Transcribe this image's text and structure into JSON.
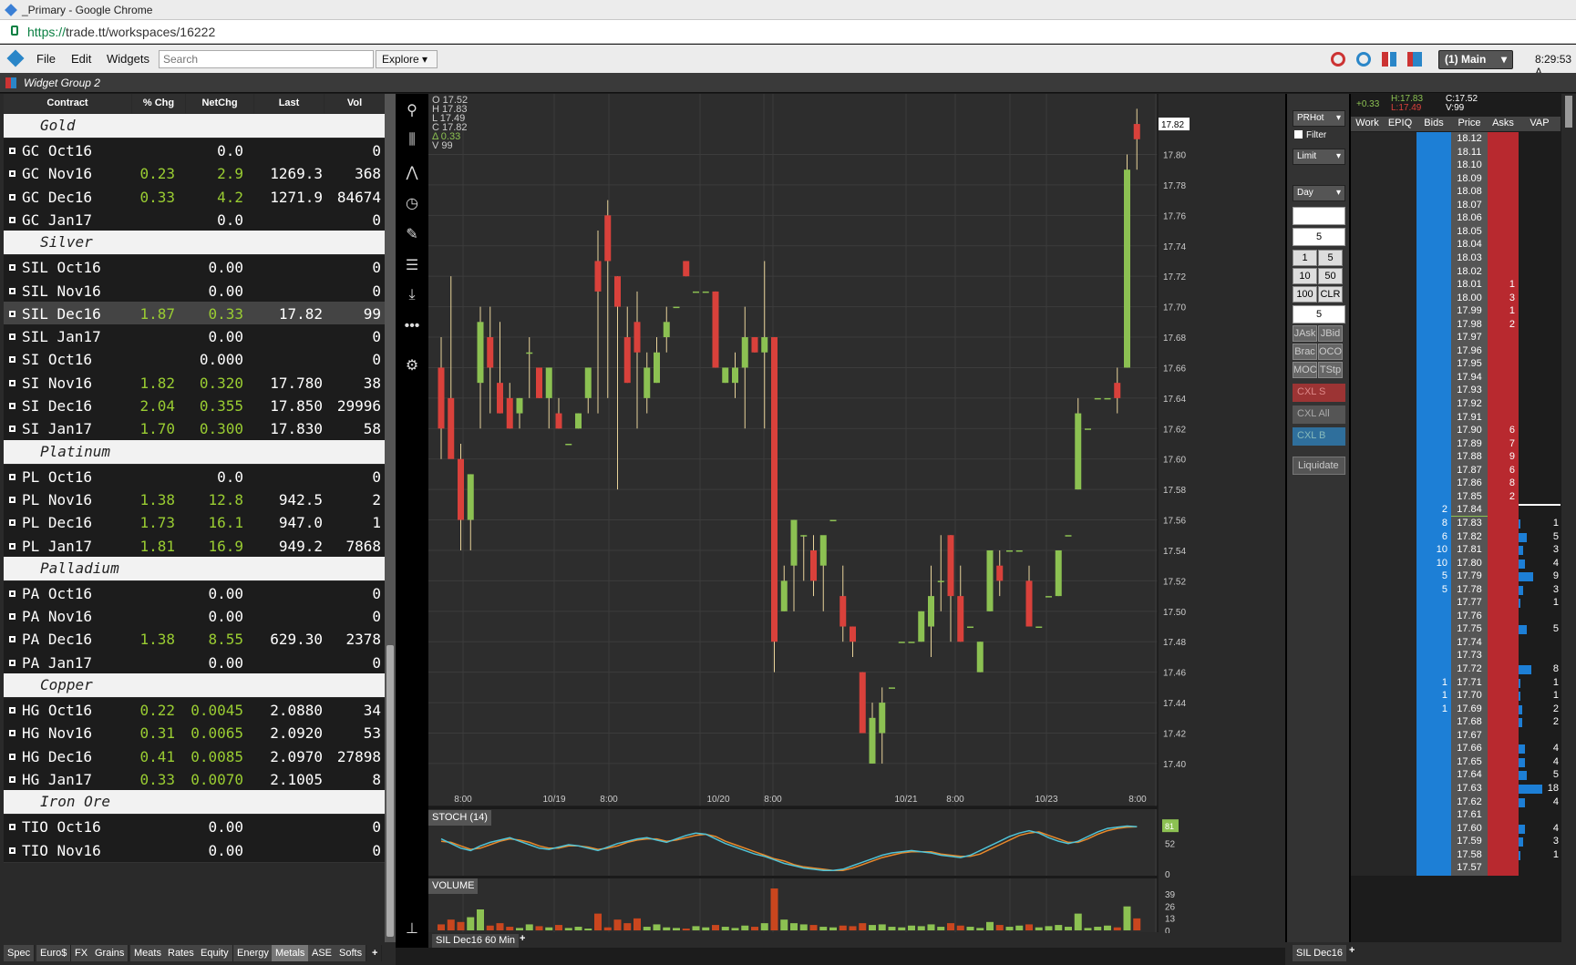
{
  "browser": {
    "window_title": "_Primary - Google Chrome",
    "url_scheme": "https://",
    "url_rest": "trade.tt/workspaces/16222"
  },
  "menu": {
    "file": "File",
    "edit": "Edit",
    "widgets": "Widgets",
    "search_placeholder": "Search",
    "explore": "Explore",
    "workspace": "(1) Main",
    "clock": "8:29:53 A"
  },
  "widget_group": "Widget Group 2",
  "watchlist": {
    "headers": [
      "Contract",
      "% Chg",
      "NetChg",
      "Last",
      "Vol"
    ],
    "groups": [
      {
        "name": "Gold",
        "rows": [
          [
            "GC Oct16",
            "",
            "0.0",
            "",
            "0"
          ],
          [
            "GC Nov16",
            "0.23",
            "2.9",
            "1269.3",
            "368"
          ],
          [
            "GC Dec16",
            "0.33",
            "4.2",
            "1271.9",
            "84674"
          ],
          [
            "GC Jan17",
            "",
            "0.0",
            "",
            "0"
          ]
        ]
      },
      {
        "name": "Silver",
        "rows": [
          [
            "SIL Oct16",
            "",
            "0.00",
            "",
            "0"
          ],
          [
            "SIL Nov16",
            "",
            "0.00",
            "",
            "0"
          ],
          [
            "SIL Dec16",
            "1.87",
            "0.33",
            "17.82",
            "99"
          ],
          [
            "SIL Jan17",
            "",
            "0.00",
            "",
            "0"
          ],
          [
            "SI Oct16",
            "",
            "0.000",
            "",
            "0"
          ],
          [
            "SI Nov16",
            "1.82",
            "0.320",
            "17.780",
            "38"
          ],
          [
            "SI Dec16",
            "2.04",
            "0.355",
            "17.850",
            "29996"
          ],
          [
            "SI Jan17",
            "1.70",
            "0.300",
            "17.830",
            "58"
          ]
        ]
      },
      {
        "name": "Platinum",
        "rows": [
          [
            "PL Oct16",
            "",
            "0.0",
            "",
            "0"
          ],
          [
            "PL Nov16",
            "1.38",
            "12.8",
            "942.5",
            "2"
          ],
          [
            "PL Dec16",
            "1.73",
            "16.1",
            "947.0",
            "1"
          ],
          [
            "PL Jan17",
            "1.81",
            "16.9",
            "949.2",
            "7868"
          ]
        ]
      },
      {
        "name": "Palladium",
        "rows": [
          [
            "PA Oct16",
            "",
            "0.00",
            "",
            "0"
          ],
          [
            "PA Nov16",
            "",
            "0.00",
            "",
            "0"
          ],
          [
            "PA Dec16",
            "1.38",
            "8.55",
            "629.30",
            "2378"
          ],
          [
            "PA Jan17",
            "",
            "0.00",
            "",
            "0"
          ]
        ]
      },
      {
        "name": "Copper",
        "rows": [
          [
            "HG Oct16",
            "0.22",
            "0.0045",
            "2.0880",
            "34"
          ],
          [
            "HG Nov16",
            "0.31",
            "0.0065",
            "2.0920",
            "53"
          ],
          [
            "HG Dec16",
            "0.41",
            "0.0085",
            "2.0970",
            "27898"
          ],
          [
            "HG Jan17",
            "0.33",
            "0.0070",
            "2.1005",
            "8"
          ]
        ]
      },
      {
        "name": "Iron Ore",
        "rows": [
          [
            "TIO Oct16",
            "",
            "0.00",
            "",
            "0"
          ],
          [
            "TIO Nov16",
            "",
            "0.00",
            "",
            "0"
          ]
        ]
      }
    ],
    "tabs": [
      "Spec",
      "Euro$",
      "FX",
      "Grains",
      "Meats",
      "Rates",
      "Equity",
      "Energy",
      "Metals",
      "ASE",
      "Softs"
    ],
    "active_tab": "Metals"
  },
  "chart": {
    "ohlc_lines": [
      "O 17.52",
      "H 17.83",
      "L 17.49",
      "C 17.82",
      "Δ  0.33",
      "V    99"
    ],
    "last_price_label": "17.82",
    "y_ticks": [
      "17.80",
      "17.78",
      "17.76",
      "17.74",
      "17.72",
      "17.70",
      "17.68",
      "17.66",
      "17.64",
      "17.62",
      "17.60",
      "17.58",
      "17.56",
      "17.54",
      "17.52",
      "17.50",
      "17.48",
      "17.46",
      "17.44",
      "17.42",
      "17.40"
    ],
    "x_labels": [
      "8:00",
      "10/19",
      "8:00",
      "10/20",
      "8:00",
      "10/21",
      "8:00",
      "10/23",
      "8:00"
    ],
    "stoch_label": "STOCH (14)",
    "stoch_ticks": [
      "52",
      "0"
    ],
    "stoch_badge": "81",
    "volume_label": "VOLUME",
    "volume_ticks": [
      "39",
      "26",
      "13",
      "0"
    ],
    "tab": "SIL Dec16 60 Min",
    "colors": {
      "up": "#8cc152",
      "down": "#d9413b",
      "stoch_k": "#4fc3d7",
      "stoch_d": "#e8892b"
    }
  },
  "chart_data": {
    "type": "candlestick",
    "ylim": [
      17.39,
      17.83
    ],
    "candles": [
      [
        17.66,
        17.68,
        17.6,
        17.62
      ],
      [
        17.64,
        17.72,
        17.62,
        17.6
      ],
      [
        17.6,
        17.61,
        17.54,
        17.56
      ],
      [
        17.56,
        17.59,
        17.54,
        17.59
      ],
      [
        17.65,
        17.7,
        17.62,
        17.69
      ],
      [
        17.68,
        17.7,
        17.63,
        17.66
      ],
      [
        17.65,
        17.69,
        17.63,
        17.63
      ],
      [
        17.64,
        17.65,
        17.62,
        17.62
      ],
      [
        17.63,
        17.64,
        17.62,
        17.64
      ],
      [
        17.67,
        17.68,
        17.64,
        17.67
      ],
      [
        17.66,
        17.66,
        17.64,
        17.64
      ],
      [
        17.64,
        17.66,
        17.62,
        17.66
      ],
      [
        17.63,
        17.64,
        17.62,
        17.62
      ],
      [
        17.61,
        17.61,
        17.61,
        17.61
      ],
      [
        17.62,
        17.63,
        17.62,
        17.63
      ],
      [
        17.64,
        17.66,
        17.63,
        17.66
      ],
      [
        17.73,
        17.75,
        17.63,
        17.71
      ],
      [
        17.76,
        17.77,
        17.64,
        17.73
      ],
      [
        17.72,
        17.72,
        17.58,
        17.7
      ],
      [
        17.68,
        17.7,
        17.65,
        17.65
      ],
      [
        17.69,
        17.71,
        17.62,
        17.67
      ],
      [
        17.64,
        17.67,
        17.63,
        17.66
      ],
      [
        17.65,
        17.68,
        17.65,
        17.67
      ],
      [
        17.68,
        17.7,
        17.67,
        17.69
      ],
      [
        17.7,
        17.7,
        17.7,
        17.7
      ],
      [
        17.73,
        17.73,
        17.72,
        17.72
      ],
      [
        17.71,
        17.71,
        17.71,
        17.71
      ],
      [
        17.71,
        17.71,
        17.71,
        17.71
      ],
      [
        17.71,
        17.71,
        17.66,
        17.66
      ],
      [
        17.65,
        17.66,
        17.65,
        17.66
      ],
      [
        17.65,
        17.67,
        17.64,
        17.66
      ],
      [
        17.66,
        17.7,
        17.62,
        17.68
      ],
      [
        17.68,
        17.68,
        17.67,
        17.67
      ],
      [
        17.67,
        17.73,
        17.62,
        17.68
      ],
      [
        17.68,
        17.68,
        17.46,
        17.48
      ],
      [
        17.5,
        17.53,
        17.5,
        17.52
      ],
      [
        17.53,
        17.56,
        17.5,
        17.56
      ],
      [
        17.55,
        17.55,
        17.52,
        17.55
      ],
      [
        17.54,
        17.55,
        17.51,
        17.52
      ],
      [
        17.53,
        17.54,
        17.5,
        17.55
      ],
      [
        17.56,
        17.56,
        17.56,
        17.56
      ],
      [
        17.51,
        17.53,
        17.48,
        17.49
      ],
      [
        17.49,
        17.49,
        17.47,
        17.48
      ],
      [
        17.46,
        17.46,
        17.42,
        17.42
      ],
      [
        17.4,
        17.44,
        17.4,
        17.43
      ],
      [
        17.42,
        17.45,
        17.4,
        17.44
      ],
      [
        17.45,
        17.45,
        17.45,
        17.45
      ],
      [
        17.48,
        17.48,
        17.48,
        17.48
      ],
      [
        17.48,
        17.48,
        17.48,
        17.48
      ],
      [
        17.48,
        17.5,
        17.48,
        17.5
      ],
      [
        17.49,
        17.53,
        17.47,
        17.51
      ],
      [
        17.52,
        17.55,
        17.5,
        17.52
      ],
      [
        17.55,
        17.55,
        17.48,
        17.51
      ],
      [
        17.51,
        17.53,
        17.48,
        17.48
      ],
      [
        17.49,
        17.49,
        17.49,
        17.49
      ],
      [
        17.46,
        17.48,
        17.46,
        17.48
      ],
      [
        17.5,
        17.54,
        17.5,
        17.54
      ],
      [
        17.53,
        17.54,
        17.51,
        17.52
      ],
      [
        17.54,
        17.54,
        17.54,
        17.54
      ],
      [
        17.54,
        17.54,
        17.54,
        17.54
      ],
      [
        17.52,
        17.53,
        17.49,
        17.49
      ],
      [
        17.49,
        17.49,
        17.49,
        17.49
      ],
      [
        17.51,
        17.51,
        17.51,
        17.51
      ],
      [
        17.51,
        17.54,
        17.51,
        17.54
      ],
      [
        17.55,
        17.55,
        17.55,
        17.55
      ],
      [
        17.58,
        17.64,
        17.58,
        17.63
      ],
      [
        17.62,
        17.62,
        17.62,
        17.62
      ],
      [
        17.64,
        17.64,
        17.64,
        17.64
      ],
      [
        17.64,
        17.64,
        17.64,
        17.64
      ],
      [
        17.65,
        17.66,
        17.63,
        17.64
      ],
      [
        17.66,
        17.8,
        17.66,
        17.79
      ],
      [
        17.82,
        17.83,
        17.79,
        17.81
      ]
    ],
    "stoch_k": [
      60,
      52,
      44,
      40,
      48,
      54,
      58,
      62,
      56,
      50,
      44,
      42,
      46,
      50,
      48,
      44,
      40,
      46,
      52,
      56,
      60,
      62,
      58,
      54,
      60,
      66,
      70,
      68,
      60,
      52,
      46,
      40,
      34,
      30,
      24,
      18,
      14,
      10,
      8,
      6,
      6,
      8,
      14,
      20,
      26,
      32,
      36,
      38,
      40,
      38,
      36,
      32,
      30,
      28,
      32,
      40,
      48,
      56,
      64,
      70,
      74,
      70,
      62,
      56,
      52,
      56,
      64,
      72,
      78,
      80,
      82,
      81
    ],
    "stoch_d": [
      56,
      54,
      48,
      42,
      44,
      50,
      56,
      60,
      58,
      54,
      48,
      44,
      44,
      48,
      48,
      46,
      42,
      44,
      48,
      54,
      58,
      60,
      60,
      56,
      58,
      62,
      66,
      68,
      64,
      56,
      50,
      44,
      38,
      32,
      26,
      22,
      16,
      12,
      10,
      8,
      6,
      6,
      10,
      16,
      22,
      28,
      32,
      36,
      38,
      38,
      38,
      34,
      32,
      30,
      30,
      34,
      42,
      50,
      58,
      66,
      70,
      72,
      66,
      60,
      54,
      54,
      60,
      68,
      74,
      78,
      80,
      81
    ],
    "volume": [
      10,
      18,
      14,
      22,
      35,
      8,
      12,
      6,
      4,
      10,
      7,
      5,
      9,
      4,
      6,
      3,
      28,
      5,
      18,
      12,
      20,
      6,
      10,
      5,
      4,
      3,
      7,
      5,
      9,
      6,
      4,
      8,
      6,
      12,
      70,
      18,
      12,
      10,
      9,
      6,
      5,
      8,
      7,
      12,
      9,
      10,
      6,
      5,
      8,
      7,
      10,
      6,
      12,
      8,
      6,
      4,
      14,
      9,
      6,
      8,
      10,
      5,
      7,
      9,
      6,
      28,
      4,
      6,
      8,
      5,
      40,
      20
    ]
  },
  "order_ticket": {
    "account": "PRHot",
    "filter": "Filter",
    "order_type": "Limit",
    "tif": "Day",
    "price_value": "",
    "qty_value": "5",
    "qty_buttons": [
      "1",
      "5",
      "10",
      "50",
      "100",
      "CLR"
    ],
    "qty_value2": "5",
    "buttons": [
      [
        "JAsk",
        "JBid"
      ],
      [
        "Brac",
        "OCO"
      ],
      [
        "MOC",
        "TStp"
      ]
    ],
    "cxl_s": "CXL S",
    "cxl_all": "CXL All",
    "cxl_b": "CXL B",
    "liquidate": "Liquidate"
  },
  "ladder": {
    "change": "+0.33",
    "high": "H:17.83",
    "low": "L:17.49",
    "close": "C:17.52",
    "vol": "V:99",
    "headers": [
      "Work",
      "EPIQ",
      "Bids",
      "Price",
      "Asks",
      "VAP"
    ],
    "rows": [
      [
        "18.12",
        "",
        "",
        ""
      ],
      [
        "18.11",
        "",
        "",
        ""
      ],
      [
        "18.10",
        "",
        "",
        ""
      ],
      [
        "18.09",
        "",
        "",
        ""
      ],
      [
        "18.08",
        "",
        "",
        ""
      ],
      [
        "18.07",
        "",
        "",
        ""
      ],
      [
        "18.06",
        "",
        "",
        ""
      ],
      [
        "18.05",
        "",
        "",
        ""
      ],
      [
        "18.04",
        "",
        "",
        ""
      ],
      [
        "18.03",
        "",
        "",
        ""
      ],
      [
        "18.02",
        "",
        "",
        ""
      ],
      [
        "18.01",
        "",
        "1",
        ""
      ],
      [
        "18.00",
        "",
        "3",
        ""
      ],
      [
        "17.99",
        "",
        "1",
        ""
      ],
      [
        "17.98",
        "",
        "2",
        ""
      ],
      [
        "17.97",
        "",
        "",
        ""
      ],
      [
        "17.96",
        "",
        "",
        ""
      ],
      [
        "17.95",
        "",
        "",
        ""
      ],
      [
        "17.94",
        "",
        "",
        ""
      ],
      [
        "17.93",
        "",
        "",
        ""
      ],
      [
        "17.92",
        "",
        "",
        ""
      ],
      [
        "17.91",
        "",
        "",
        ""
      ],
      [
        "17.90",
        "",
        "6",
        ""
      ],
      [
        "17.89",
        "",
        "7",
        ""
      ],
      [
        "17.88",
        "",
        "9",
        ""
      ],
      [
        "17.87",
        "",
        "6",
        ""
      ],
      [
        "17.86",
        "",
        "8",
        ""
      ],
      [
        "17.85",
        "",
        "2",
        ""
      ],
      [
        "17.84",
        "2",
        "",
        ""
      ],
      [
        "17.83",
        "8",
        "",
        "1"
      ],
      [
        "17.82",
        "6",
        "",
        "5"
      ],
      [
        "17.81",
        "10",
        "",
        "3"
      ],
      [
        "17.80",
        "10",
        "",
        "4"
      ],
      [
        "17.79",
        "5",
        "",
        "9"
      ],
      [
        "17.78",
        "5",
        "",
        "3"
      ],
      [
        "17.77",
        "",
        "",
        "1"
      ],
      [
        "17.76",
        "",
        "",
        ""
      ],
      [
        "17.75",
        "",
        "",
        "5"
      ],
      [
        "17.74",
        "",
        "",
        ""
      ],
      [
        "17.73",
        "",
        "",
        ""
      ],
      [
        "17.72",
        "",
        "",
        "8"
      ],
      [
        "17.71",
        "1",
        "",
        "1"
      ],
      [
        "17.70",
        "1",
        "",
        "1"
      ],
      [
        "17.69",
        "1",
        "",
        "2"
      ],
      [
        "17.68",
        "",
        "",
        "2"
      ],
      [
        "17.67",
        "",
        "",
        ""
      ],
      [
        "17.66",
        "",
        "",
        "4"
      ],
      [
        "17.65",
        "",
        "",
        "4"
      ],
      [
        "17.64",
        "",
        "",
        "5"
      ],
      [
        "17.63",
        "",
        "",
        "18"
      ],
      [
        "17.62",
        "",
        "",
        "4"
      ],
      [
        "17.61",
        "",
        "",
        ""
      ],
      [
        "17.60",
        "",
        "",
        "4"
      ],
      [
        "17.59",
        "",
        "",
        "3"
      ],
      [
        "17.58",
        "",
        "",
        "1"
      ],
      [
        "17.57",
        "",
        "",
        ""
      ]
    ],
    "tab": "SIL Dec16"
  }
}
